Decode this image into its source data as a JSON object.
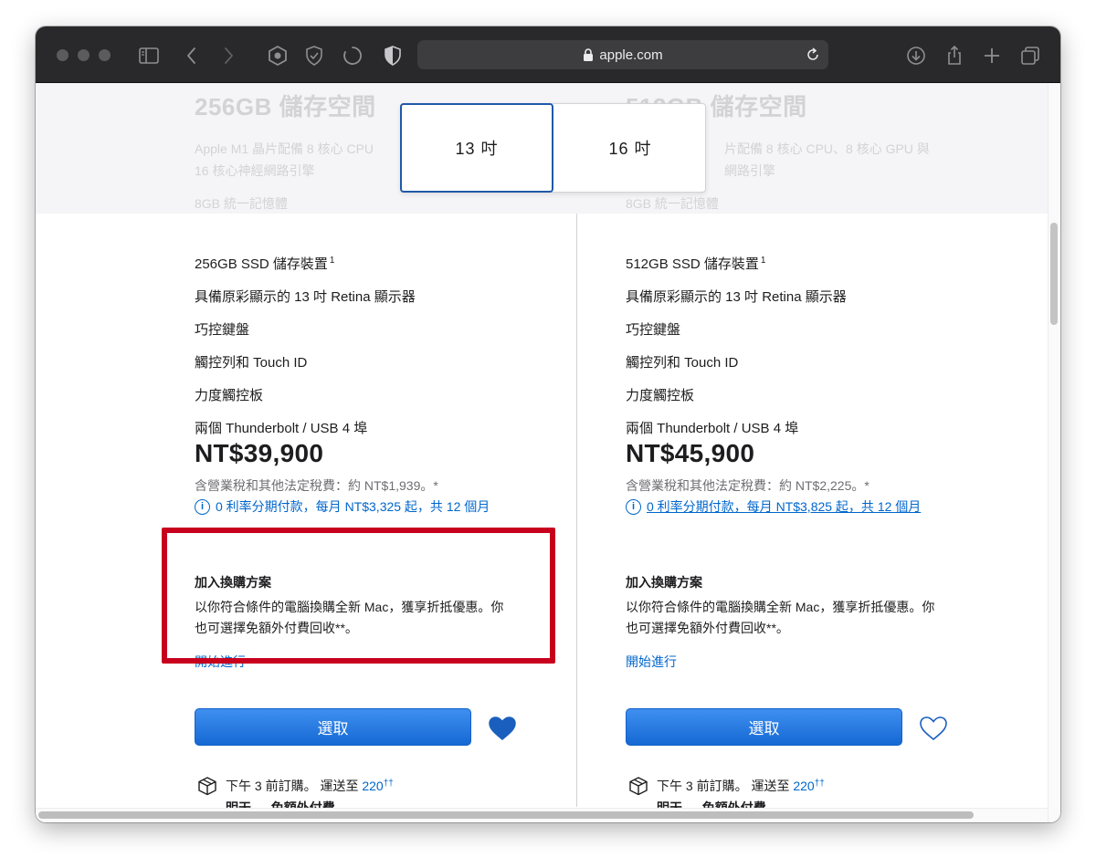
{
  "browser": {
    "url": "apple.com"
  },
  "header_faded": {
    "left_storage": "256GB 儲存空間",
    "left_line1": "Apple M1 晶片配備 8 核心 CPU",
    "left_line2": "16 核心神經網路引擎",
    "left_memory": "8GB 統一記憶體",
    "right_storage": "512GB 儲存空間",
    "right_line1": "片配備 8 核心 CPU、8 核心 GPU 與",
    "right_line2": "網路引擎",
    "right_memory": "8GB 統一記憶體"
  },
  "size_toggle": {
    "option_13": "13 吋",
    "option_16": "16 吋",
    "selected": "13 吋"
  },
  "products": [
    {
      "specs": [
        "256GB SSD 儲存裝置",
        "具備原彩顯示的 13 吋 Retina 顯示器",
        "巧控鍵盤",
        "觸控列和 Touch ID",
        "力度觸控板",
        "兩個 Thunderbolt / USB 4 埠"
      ],
      "footnote": "1",
      "price": "NT$39,900",
      "tax": "含營業稅和其他法定稅費：約 NT$1,939。*",
      "info_glyph": "i",
      "installment": "0 利率分期付款，每月 NT$3,325 起，共 12 個月",
      "trade_title": "加入換購方案",
      "trade_desc": "以你符合條件的電腦換購全新 Mac，獲享折抵優惠。你也可選擇免額外付費回收**。",
      "trade_link": "開始進行",
      "select_label": "選取",
      "favorited": true,
      "ship_line1": "下午 3 前訂購。 運送至",
      "ship_zip": "220",
      "ship_sup": "††",
      "ship_line2": "明天 — 免額外付費"
    },
    {
      "specs": [
        "512GB SSD 儲存裝置",
        "具備原彩顯示的 13 吋 Retina 顯示器",
        "巧控鍵盤",
        "觸控列和 Touch ID",
        "力度觸控板",
        "兩個 Thunderbolt / USB 4 埠"
      ],
      "footnote": "1",
      "price": "NT$45,900",
      "tax": "含營業稅和其他法定稅費：約 NT$2,225。*",
      "info_glyph": "i",
      "installment": "0 利率分期付款，每月 NT$3,825 起，共 12 個月",
      "trade_title": "加入換購方案",
      "trade_desc": "以你符合條件的電腦換購全新 Mac，獲享折抵優惠。你也可選擇免額外付費回收**。",
      "trade_link": "開始進行",
      "select_label": "選取",
      "favorited": false,
      "ship_line1": "下午 3 前訂購。 運送至",
      "ship_zip": "220",
      "ship_sup": "††",
      "ship_line2": "明天 — 免額外付費"
    }
  ],
  "colors": {
    "accent_blue": "#0066cc",
    "button_blue": "#1569d3",
    "highlight_red": "#c8001e",
    "toolbar": "#29292b"
  }
}
